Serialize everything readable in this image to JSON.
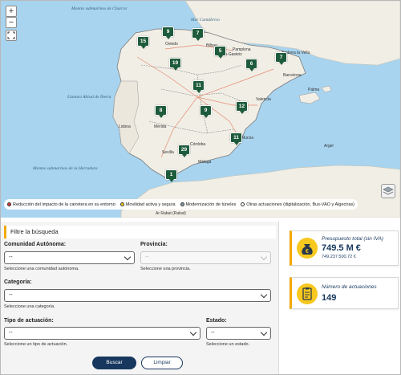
{
  "map": {
    "ocean_labels": [
      "Montes submarinos de Charcot",
      "Mar Cantábrico",
      "Llanura Abisal de Iberia",
      "Montes submarinos de la Herradura"
    ],
    "cities": [
      "Oviedo",
      "Bilbao",
      "Vitoria-Gasteiz",
      "Pamplona",
      "Andorra la Vella",
      "Barcelona",
      "Lisboa",
      "Mérida",
      "Sevilla",
      "Córdoba",
      "Murcia",
      "Argel",
      "Ar Rabat (Rabat)",
      "Málaga",
      "Valencia",
      "Palma"
    ],
    "markers": [
      "15",
      "9",
      "7",
      "5",
      "7",
      "6",
      "19",
      "11",
      "8",
      "9",
      "12",
      "29",
      "11",
      "1"
    ],
    "zoom_in": "+",
    "zoom_out": "−",
    "fullscreen_icon": "fullscreen-icon",
    "layers_icon": "layers-icon",
    "legend": [
      {
        "label": "Reducción del impacto de la carretera en su entorno",
        "color": "#e03a3a"
      },
      {
        "label": "Movilidad activa y segura",
        "color": "#f3d21b"
      },
      {
        "label": "Modernización de túneles",
        "color": "#8c9ca8"
      },
      {
        "label": "Otras actuaciones (digitalización, Bus-VAO y Algeciras)",
        "color": "#ffffff"
      }
    ]
  },
  "filter": {
    "title": "Filtre la búsqueda",
    "comunidad": {
      "label": "Comunidad Autónoma:",
      "value": "--",
      "help": "Seleccione una comunidad autónoma."
    },
    "provincia": {
      "label": "Provincia:",
      "value": "--",
      "help": "Seleccione una provincia."
    },
    "categoria": {
      "label": "Categoría:",
      "value": "--",
      "help": "Seleccione una categoría."
    },
    "tipo": {
      "label": "Tipo de actuación:",
      "value": "--",
      "help": "Seleccione un tipo de actuación."
    },
    "estado": {
      "label": "Estado:",
      "value": "--",
      "help": "Seleccione un estado."
    },
    "buscar": "Buscar",
    "limpiar": "Limpiar"
  },
  "stats": {
    "presupuesto": {
      "label": "Presupuesto total (sin IVA)",
      "value": "749.5 M €",
      "sub": "749.237.500,72 €",
      "icon": "money-bag-icon"
    },
    "actuaciones": {
      "label": "Número de actuaciones",
      "value": "149",
      "icon": "clipboard-icon"
    }
  },
  "colors": {
    "accent": "#f2a900",
    "marker": "#1e5b3b",
    "navy": "#17375e",
    "sea": "#a8d4ef",
    "land": "#f1eee6"
  }
}
